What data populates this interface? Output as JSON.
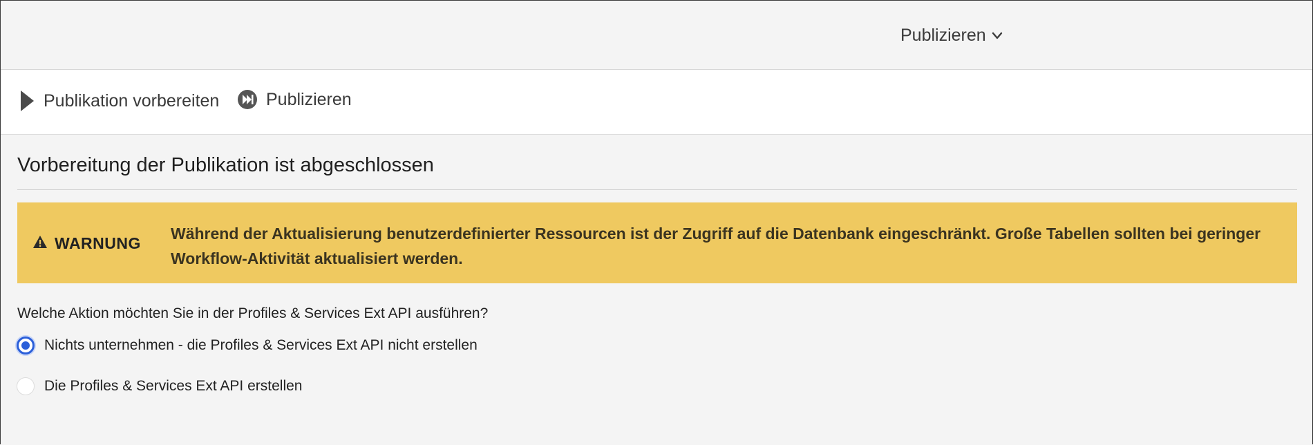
{
  "header": {
    "publish_menu_label": "Publizieren"
  },
  "steps": {
    "prepare_label": "Publikation vorbereiten",
    "publish_label": "Publizieren"
  },
  "main": {
    "section_title": "Vorbereitung der Publikation ist abgeschlossen",
    "warning": {
      "label": "WARNUNG",
      "text_line1": "Während der Aktualisierung benutzerdefinierter Ressourcen ist der Zugriff auf die Datenbank eingeschränkt. Große Tabellen sollten bei geringer",
      "text_line2": "Workflow-Aktivität aktualisiert werden.",
      "color": "#efc960",
      "icon": "warning-triangle-icon"
    },
    "question": "Welche Aktion möchten Sie in der Profiles & Services Ext API ausführen?",
    "options": [
      {
        "label": "Nichts unternehmen - die Profiles & Services Ext API nicht erstellen",
        "selected": true
      },
      {
        "label": "Die Profiles & Services Ext API erstellen",
        "selected": false
      }
    ]
  },
  "colors": {
    "accent": "#2b5fd9",
    "warning_bg": "#efc960",
    "page_bg": "#f4f4f4"
  }
}
